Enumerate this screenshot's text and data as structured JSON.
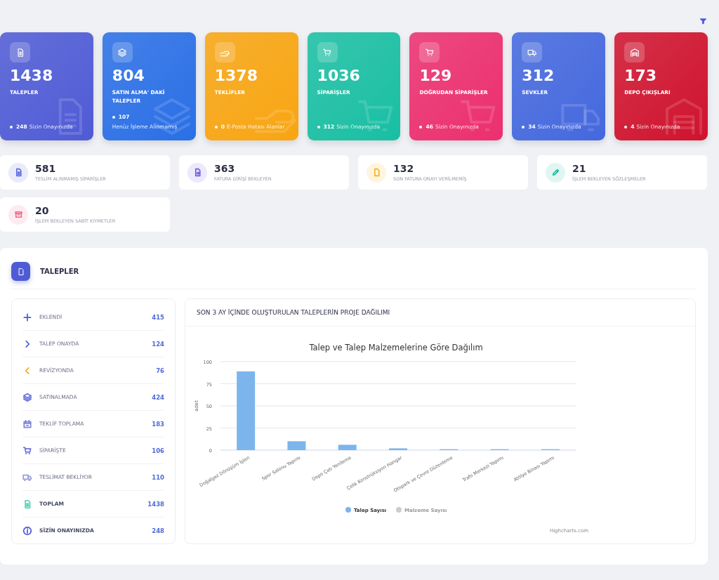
{
  "summary_cards": [
    {
      "value": "1438",
      "label": "TALEPLER",
      "kind": "document",
      "color": "#4f5bd5",
      "footer_count": "248",
      "footer_text": "Sizin Onayınızda",
      "stacked": false
    },
    {
      "value": "804",
      "label": "SATIN ALMA' DAKİ TALEPLER",
      "kind": "layers",
      "color": "#2a6fe6",
      "footer_count": "107",
      "footer_text": "Henüz İşleme Alınmamış",
      "stacked": true
    },
    {
      "value": "1378",
      "label": "TEKLİFLER",
      "kind": "hand",
      "color": "#f8a511",
      "footer_count": "0",
      "footer_text": "E-Posta Hatası Alanlar",
      "stacked": false
    },
    {
      "value": "1036",
      "label": "SİPARİŞLER",
      "kind": "cart",
      "color": "#19bfa3",
      "footer_count": "312",
      "footer_text": "Sizin Onayınızda",
      "stacked": false
    },
    {
      "value": "129",
      "label": "DOĞRUDAN SİPARİŞLER",
      "kind": "cart",
      "color": "#ec2f6f",
      "footer_count": "46",
      "footer_text": "Sizin Onayınızda",
      "stacked": false
    },
    {
      "value": "312",
      "label": "SEVKLER",
      "kind": "truck",
      "color": "#4468de",
      "footer_count": "34",
      "footer_text": "Sizin Onayınızda",
      "stacked": false
    },
    {
      "value": "173",
      "label": "DEPO ÇIKIŞLARI",
      "kind": "warehouse",
      "color": "#d0132e",
      "footer_count": "4",
      "footer_text": "Sizin Onayınızda",
      "stacked": false
    }
  ],
  "stat_tiles": [
    {
      "value": "581",
      "label": "TESLİM ALINMAMIŞ SİPARİŞLER",
      "kind": "document",
      "color": "#5b6be0"
    },
    {
      "value": "363",
      "label": "FATURA GİRİŞİ BEKLEYEN",
      "kind": "file-import",
      "color": "#6a5be0"
    },
    {
      "value": "132",
      "label": "SON FATURA ONAYI VERİLMEMİŞ",
      "kind": "file",
      "color": "#f6b21b"
    },
    {
      "value": "21",
      "label": "İŞLEM BEKLEYEN SÖZLEŞMELER",
      "kind": "edit",
      "color": "#1bb99a"
    },
    {
      "value": "20",
      "label": "İŞLEM BEKLEYEN SABİT KIYMETLER",
      "kind": "archive",
      "color": "#f06b8a"
    }
  ],
  "panel": {
    "title": "TALEPLER",
    "status_list": [
      {
        "label": "EKLENDİ",
        "count": "415",
        "kind": "plus",
        "color": "#4f5bd5",
        "emphasis": false
      },
      {
        "label": "TALEP ONAYDA",
        "count": "124",
        "kind": "chevron-right",
        "color": "#4f5bd5",
        "emphasis": false
      },
      {
        "label": "REVİZYONDA",
        "count": "76",
        "kind": "chevron-left",
        "color": "#f6a91b",
        "emphasis": false
      },
      {
        "label": "SATINALMADA",
        "count": "424",
        "kind": "layers",
        "color": "#6a72d8",
        "emphasis": false
      },
      {
        "label": "TEKLİF TOPLAMA",
        "count": "183",
        "kind": "calendar",
        "color": "#7c84dc",
        "emphasis": false
      },
      {
        "label": "SİPARİŞTE",
        "count": "106",
        "kind": "cart",
        "color": "#6a72d8",
        "emphasis": false
      },
      {
        "label": "TESLİMAT BEKLİYOR",
        "count": "110",
        "kind": "truck",
        "color": "#9aa0d8",
        "emphasis": false
      },
      {
        "label": "TOPLAM",
        "count": "1438",
        "kind": "document",
        "color": "#5fd3b8",
        "emphasis": true
      },
      {
        "label": "SİZİN ONAYINIZDA",
        "count": "248",
        "kind": "info",
        "color": "#4f5bd5",
        "emphasis": true
      }
    ],
    "chart_card": {
      "heading": "SON 3 AY İÇİNDE OLUŞTURULAN TALEPLERİN PROJE DAĞILIMI",
      "credits": "Highcharts.com",
      "chart_data": {
        "type": "bar",
        "title": "Talep ve Talep Malzemelerine Göre Dağılım",
        "ylabel": "adet",
        "categories": [
          "Doğalgaz Dönüşüm İşleri",
          "Spor Salonu Yapımı",
          "Depo Çatı Yenileme",
          "Çelik Konstrüksiyon Hangar",
          "Otopark ve Çevre Düzenleme",
          "Trafo Merkezi Yapımı",
          "Atölye Binası Yapımı"
        ],
        "series": [
          {
            "name": "Talep Sayısı",
            "color": "#7cb5ec",
            "values": [
              89,
              10,
              6,
              2,
              1,
              1,
              1
            ]
          },
          {
            "name": "Malzeme Sayısı",
            "color": "#cccccc",
            "values": [
              null,
              null,
              null,
              null,
              null,
              null,
              null
            ]
          }
        ],
        "ylim": [
          0,
          100
        ],
        "yticks": [
          0,
          25,
          50,
          75,
          100
        ],
        "grid": true
      }
    }
  }
}
